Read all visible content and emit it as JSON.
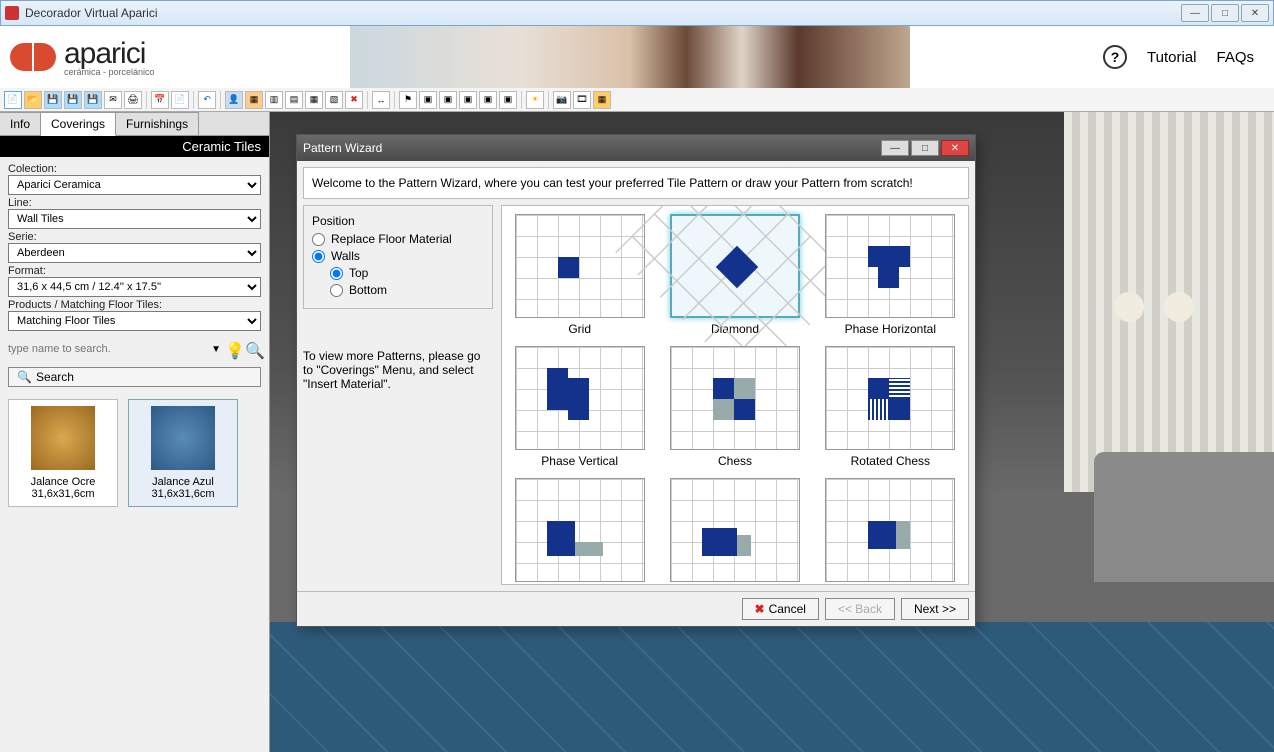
{
  "window": {
    "title": "Decorador Virtual Aparici"
  },
  "header": {
    "brand": "aparici",
    "tagline": "cerámica - porcelánico",
    "help_icon": "?",
    "tutorial": "Tutorial",
    "faqs": "FAQs"
  },
  "tabs": {
    "info": "Info",
    "coverings": "Coverings",
    "furnishings": "Furnishings"
  },
  "sidebar": {
    "section": "Ceramic Tiles",
    "fields": {
      "collection_label": "Colection:",
      "collection_value": "Aparici Ceramica",
      "line_label": "Line:",
      "line_value": "Wall Tiles",
      "serie_label": "Serie:",
      "serie_value": "Aberdeen",
      "format_label": "Format:",
      "format_value": "31,6 x 44,5 cm / 12.4'' x 17.5''",
      "products_label": "Products / Matching Floor Tiles:",
      "products_value": "Matching Floor Tiles"
    },
    "search_placeholder": "type name to search.",
    "search_btn": "Search",
    "tiles": [
      {
        "name": "Jalance Ocre",
        "size": "31,6x31,6cm"
      },
      {
        "name": "Jalance Azul",
        "size": "31,6x31,6cm"
      }
    ]
  },
  "dialog": {
    "title": "Pattern Wizard",
    "intro": "Welcome to the Pattern Wizard, where you can test your preferred Tile Pattern or draw your Pattern from scratch!",
    "position_label": "Position",
    "replace_floor": "Replace Floor Material",
    "walls": "Walls",
    "top": "Top",
    "bottom": "Bottom",
    "hint": "To view more Patterns, please go to \"Coverings\" Menu, and select \"Insert Material\".",
    "patterns": {
      "grid": "Grid",
      "diamond": "Diamond",
      "phase_h": "Phase Horizontal",
      "phase_v": "Phase Vertical",
      "chess": "Chess",
      "rotated": "Rotated Chess"
    },
    "buttons": {
      "cancel": "Cancel",
      "back": "<< Back",
      "next": "Next >>"
    }
  }
}
